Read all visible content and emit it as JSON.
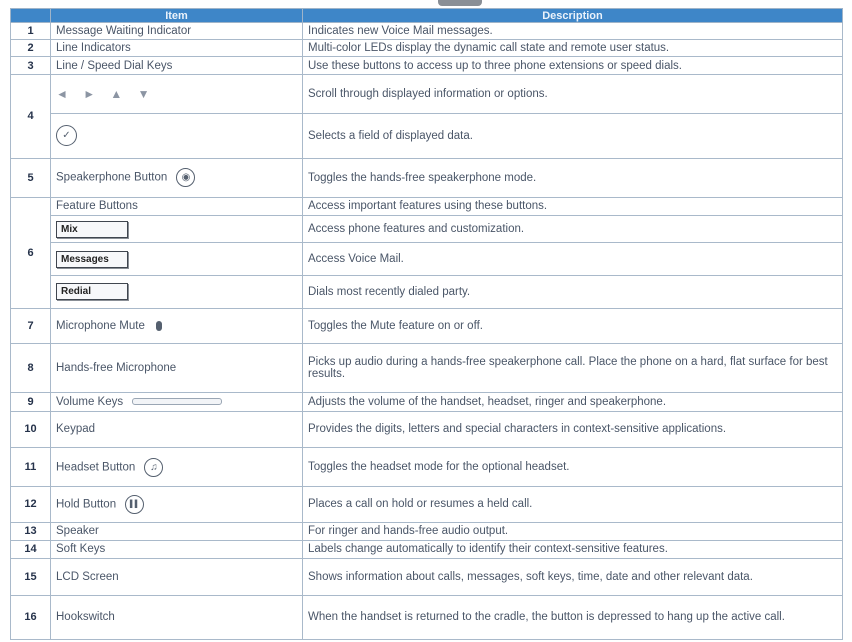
{
  "header": {
    "col_num": "",
    "col_item": "Item",
    "col_desc": "Description"
  },
  "rows": [
    {
      "num": "1",
      "item": "Message Waiting Indicator",
      "desc": "Indicates new Voice Mail messages."
    },
    {
      "num": "2",
      "item": "Line Indicators",
      "desc": "Multi-color LEDs display the dynamic call state and remote user status."
    },
    {
      "num": "3",
      "item": "Line / Speed Dial Keys",
      "desc": "Use these buttons to access up to three phone extensions or speed dials."
    },
    {
      "num": "4",
      "item_icons": "◄ ► ▲ ▼",
      "desc": "Scroll through displayed information or options."
    },
    {
      "item_icon": "✓",
      "desc": "Selects a field of displayed data."
    },
    {
      "num": "5",
      "item": "Speakerphone Button",
      "item_icon": "◉",
      "desc": "Toggles the hands-free speakerphone mode."
    },
    {
      "num": "6",
      "item": "Feature Buttons",
      "desc": "Access important features using these buttons."
    },
    {
      "softkey": "Mix",
      "desc": "Access phone features and customization."
    },
    {
      "softkey": "Messages",
      "desc": "Access Voice Mail."
    },
    {
      "softkey": "Redial",
      "desc": "Dials most recently dialed party."
    },
    {
      "num": "7",
      "item": "Microphone Mute",
      "desc": "Toggles the Mute feature on or off."
    },
    {
      "num": "8",
      "item": "Hands-free Microphone",
      "desc": "Picks up audio during a hands-free speakerphone call. Place the phone on a hard, flat surface for best results."
    },
    {
      "num": "9",
      "item": "Volume Keys",
      "desc": "Adjusts the volume of the handset, headset, ringer and speakerphone."
    },
    {
      "num": "10",
      "item": "Keypad",
      "desc": "Provides the digits, letters and special characters in context-sensitive applications."
    },
    {
      "num": "11",
      "item": "Headset Button",
      "item_icon": "♫",
      "desc": "Toggles the headset mode for the optional headset."
    },
    {
      "num": "12",
      "item": "Hold Button",
      "item_icon": "▌▌",
      "desc": "Places a call on hold or resumes a held call."
    },
    {
      "num": "13",
      "item": "Speaker",
      "desc": "For ringer and hands-free audio output."
    },
    {
      "num": "14",
      "item": "Soft Keys",
      "desc": "Labels change automatically to identify their context-sensitive features."
    },
    {
      "num": "15",
      "item": "LCD Screen",
      "desc": "Shows information about calls, messages, soft keys, time, date and other relevant data."
    },
    {
      "num": "16",
      "item": "Hookswitch",
      "desc": "When the handset is returned to the cradle, the button is depressed to hang up the active call."
    }
  ]
}
